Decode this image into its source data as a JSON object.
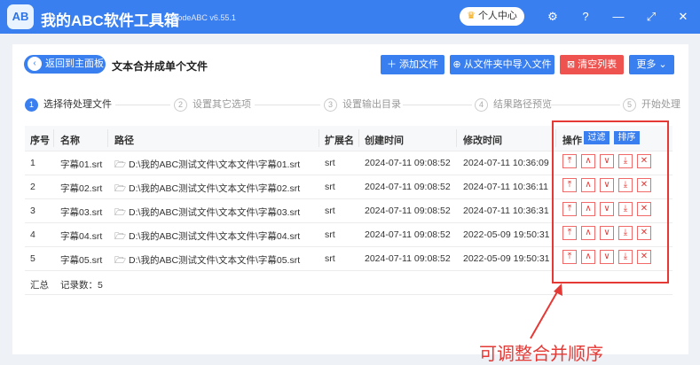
{
  "app": {
    "logo_text": "AB",
    "title": "我的ABC软件工具箱",
    "version": "WodeABC v6.55.1",
    "user_center": "个人中心",
    "icons": [
      "gear-icon",
      "help-icon",
      "minimize-icon",
      "fullscreen-icon",
      "close-icon"
    ]
  },
  "toolbar": {
    "back_label": "返回到主面板",
    "page_title": "文本合并成单个文件",
    "add_file": "添加文件",
    "import_folder": "从文件夹中导入文件",
    "clear_list": "清空列表",
    "more": "更多"
  },
  "steps": [
    {
      "num": "1",
      "label": "选择待处理文件"
    },
    {
      "num": "2",
      "label": "设置其它选项"
    },
    {
      "num": "3",
      "label": "设置输出目录"
    },
    {
      "num": "4",
      "label": "结果路径预览"
    },
    {
      "num": "5",
      "label": "开始处理"
    }
  ],
  "table": {
    "headers": {
      "index": "序号",
      "name": "名称",
      "path": "路径",
      "ext": "扩展名",
      "created": "创建时间",
      "modified": "修改时间",
      "actions": "操作"
    },
    "filter_label": "过滤",
    "sort_label": "排序",
    "rows": [
      {
        "index": "1",
        "name": "字幕01.srt",
        "path": "D:\\我的ABC测试文件\\文本文件\\字幕01.srt",
        "ext": "srt",
        "created": "2024-07-11 09:08:52",
        "modified": "2024-07-11 10:36:09"
      },
      {
        "index": "2",
        "name": "字幕02.srt",
        "path": "D:\\我的ABC测试文件\\文本文件\\字幕02.srt",
        "ext": "srt",
        "created": "2024-07-11 09:08:52",
        "modified": "2024-07-11 10:36:11"
      },
      {
        "index": "3",
        "name": "字幕03.srt",
        "path": "D:\\我的ABC测试文件\\文本文件\\字幕03.srt",
        "ext": "srt",
        "created": "2024-07-11 09:08:52",
        "modified": "2024-07-11 10:36:31"
      },
      {
        "index": "4",
        "name": "字幕04.srt",
        "path": "D:\\我的ABC测试文件\\文本文件\\字幕04.srt",
        "ext": "srt",
        "created": "2024-07-11 09:08:52",
        "modified": "2022-05-09 19:50:31"
      },
      {
        "index": "5",
        "name": "字幕05.srt",
        "path": "D:\\我的ABC测试文件\\文本文件\\字幕05.srt",
        "ext": "srt",
        "created": "2024-07-11 09:08:52",
        "modified": "2022-05-09 19:50:31"
      }
    ],
    "row_actions": [
      {
        "name": "move-top",
        "glyph": "⤒"
      },
      {
        "name": "move-up",
        "glyph": "∧"
      },
      {
        "name": "move-down",
        "glyph": "∨"
      },
      {
        "name": "move-bottom",
        "glyph": "⤓"
      },
      {
        "name": "delete",
        "glyph": "✕"
      }
    ],
    "summary_label": "汇总",
    "record_count": "记录数：5"
  },
  "annotation": "可调整合并顺序",
  "colors": {
    "accent": "#3a7ff0",
    "danger": "#ef5350",
    "annotation": "#e53935"
  }
}
